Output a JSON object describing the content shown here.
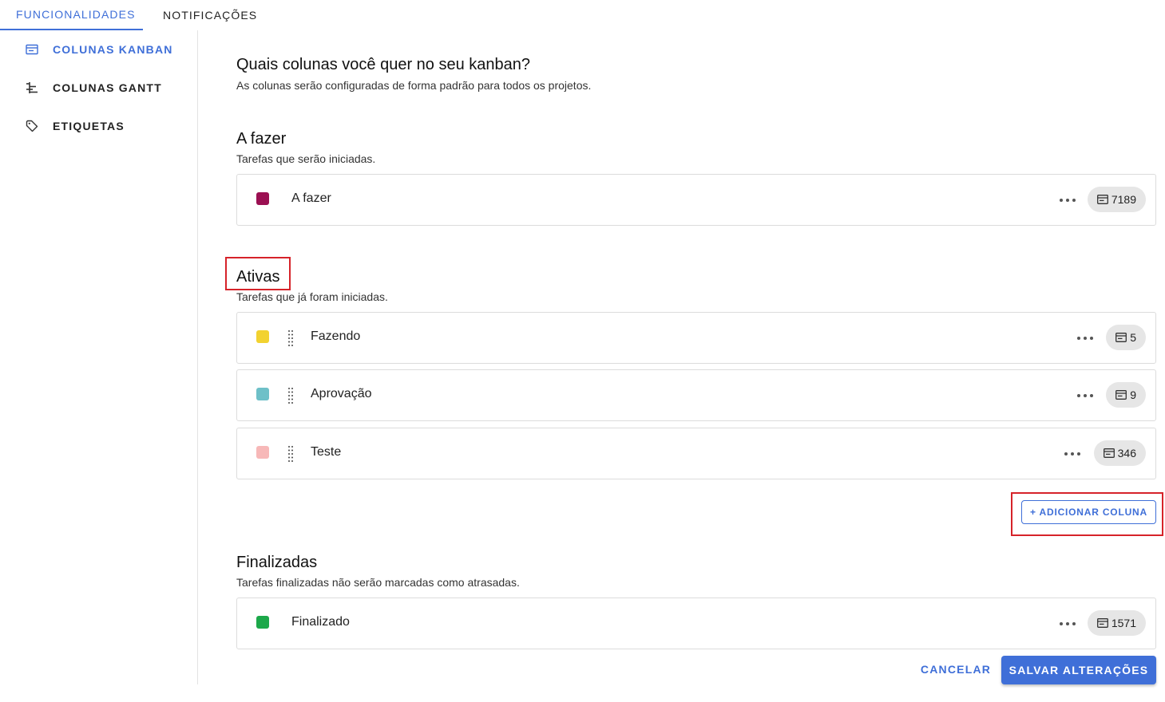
{
  "tabs": [
    {
      "label": "FUNCIONALIDADES",
      "active": true
    },
    {
      "label": "NOTIFICAÇÕES",
      "active": false
    }
  ],
  "sidebar": {
    "items": [
      {
        "label": "COLUNAS KANBAN",
        "icon": "kanban-columns-icon",
        "active": true
      },
      {
        "label": "COLUNAS GANTT",
        "icon": "gantt-columns-icon",
        "active": false
      },
      {
        "label": "ETIQUETAS",
        "icon": "tag-icon",
        "active": false
      }
    ]
  },
  "main": {
    "title": "Quais colunas você quer no seu kanban?",
    "subtitle": "As colunas serão configuradas de forma padrão para todos os projetos.",
    "sections": [
      {
        "title": "A fazer",
        "description": "Tarefas que serão iniciadas.",
        "columns": [
          {
            "label": "A fazer",
            "color": "#9b1052",
            "count": "7189"
          }
        ]
      },
      {
        "title": "Ativas",
        "description": "Tarefas que já foram iniciadas.",
        "columns": [
          {
            "label": "Fazendo",
            "color": "#f2d230",
            "count": "5"
          },
          {
            "label": "Aprovação",
            "color": "#6ec0c8",
            "count": "9"
          },
          {
            "label": "Teste",
            "color": "#f7b8b8",
            "count": "346"
          }
        ]
      },
      {
        "title": "Finalizadas",
        "description": "Tarefas finalizadas não serão marcadas como atrasadas.",
        "columns": [
          {
            "label": "Finalizado",
            "color": "#1ca84a",
            "count": "1571"
          }
        ]
      }
    ],
    "add_column_label": "+ ADICIONAR COLUNA"
  },
  "footer": {
    "cancel_label": "CANCELAR",
    "save_label": "SALVAR ALTERAÇÕES"
  },
  "colors": {
    "accent": "#3f6fd8",
    "highlight": "#d6232a"
  }
}
